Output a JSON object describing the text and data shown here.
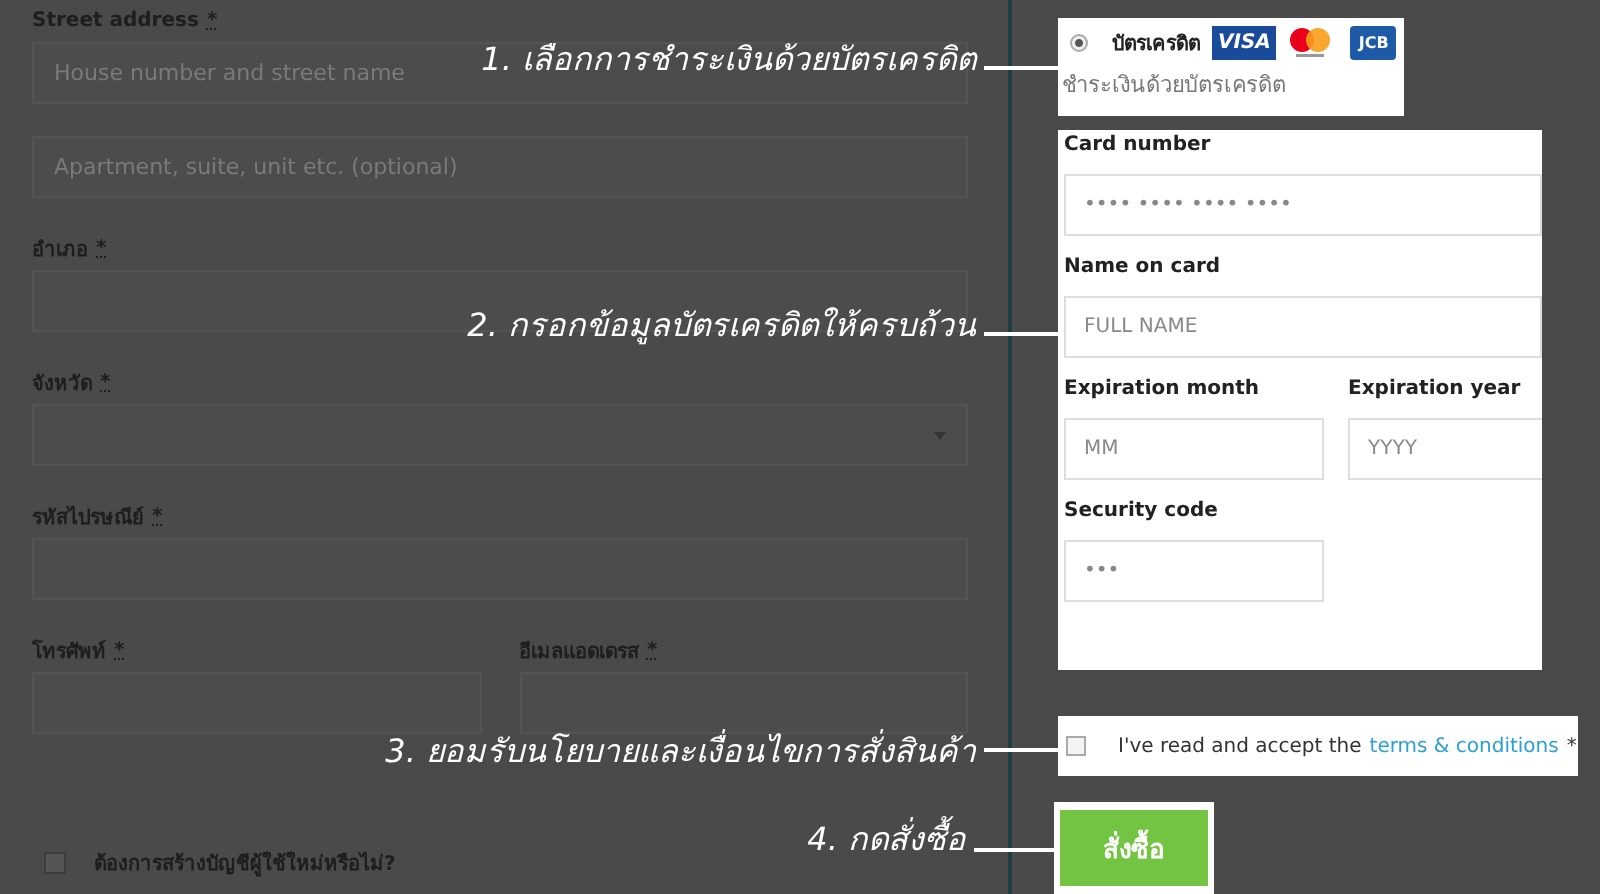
{
  "billing_form": {
    "rows": [
      [
        {
          "kind": "text",
          "label": "Street address",
          "mark": "*",
          "placeholder": "House number and street name"
        }
      ],
      [
        {
          "kind": "text",
          "placeholder": "Apartment, suite, unit etc. (optional)"
        }
      ],
      [
        {
          "kind": "text",
          "label": "อำเภอ",
          "mark": "*"
        }
      ],
      [
        {
          "kind": "select",
          "label": "จังหวัด",
          "mark": "*"
        }
      ],
      [
        {
          "kind": "text",
          "label": "รหัสไปรษณีย์",
          "mark": "*"
        }
      ],
      [
        {
          "kind": "text",
          "label": "โทรศัพท์",
          "mark": "*"
        },
        {
          "kind": "text",
          "label": "อีเมลแอดเดรส",
          "mark": "*"
        }
      ]
    ],
    "create_account": {
      "label": "ต้องการสร้างบัญชีผู้ใช้ใหม่หรือไม่?",
      "checked": false
    }
  },
  "payment": {
    "method": {
      "label": "บัตรเครดิต",
      "selected": true,
      "description": "ชำระเงินด้วยบัตรเครดิต"
    },
    "card_logos": [
      {
        "kind": "visa",
        "text": "VISA"
      },
      {
        "kind": "mastercard"
      },
      {
        "kind": "jcb",
        "text": "JCB"
      }
    ],
    "card_form": [
      [
        {
          "label": "Card number",
          "placeholder": "•••• •••• •••• ••••"
        }
      ],
      [
        {
          "label": "Name on card",
          "placeholder": "FULL NAME"
        }
      ],
      [
        {
          "label": "Expiration month",
          "placeholder": "MM"
        },
        {
          "label": "Expiration year",
          "placeholder": "YYYY"
        }
      ],
      [
        {
          "label": "Security code",
          "placeholder": "•••"
        }
      ]
    ],
    "terms": {
      "text": "I've read and accept the",
      "link": "terms & conditions",
      "mark": "*",
      "checked": false
    },
    "order_button": "สั่งซื้อ"
  },
  "annotations": [
    {
      "text": "1. เลือกการชำระเงินด้วยบัตรเครดิต"
    },
    {
      "text": "2. กรอกข้อมูลบัตรเครดิตให้ครบถ้วน"
    },
    {
      "text": "3. ยอมรับนโยบายและเงื่อนไขการสั่งสินค้า"
    },
    {
      "text": "4. กดสั่งซื้อ"
    }
  ]
}
